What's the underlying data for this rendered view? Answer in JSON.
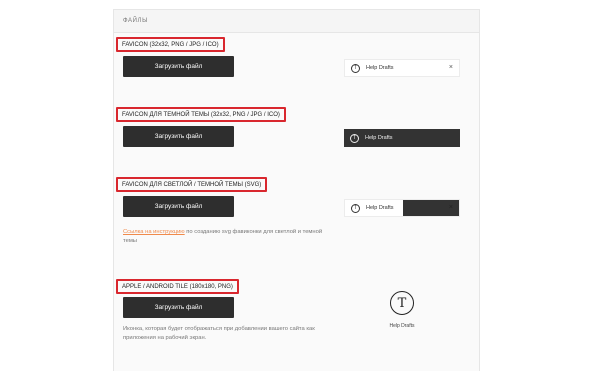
{
  "panel": {
    "title": "ФАЙЛЫ"
  },
  "sections": [
    {
      "label": "FAVICON (32x32, PNG / JPG / ICO)",
      "button": "Загрузить файл"
    },
    {
      "label": "FAVICON ДЛЯ ТЕМНОЙ ТЕМЫ (32x32, PNG / JPG / ICO)",
      "button": "Загрузить файл"
    },
    {
      "label": "FAVICON ДЛЯ СВЕТЛОЙ / ТЕМНОЙ ТЕМЫ (SVG)",
      "button": "Загрузить файл",
      "link": "Ссылка на инструкцию",
      "note": " по созданию svg фавиконки для светлой и темной темы"
    },
    {
      "label": "APPLE / ANDROID TILE (180x180, PNG)",
      "button": "Загрузить файл",
      "note": "Иконка, которая будет отображаться при добавлении вашего сайта как приложения на рабочий экран."
    }
  ],
  "previews": {
    "tab_title": "Help Drafts",
    "close_glyph": "×",
    "favicon_glyph": "T",
    "tile_caption": "Help Drafts",
    "tile_glyph": "T",
    "icons": [
      "favicon-icon",
      "close-icon",
      "app-tile-icon"
    ]
  }
}
